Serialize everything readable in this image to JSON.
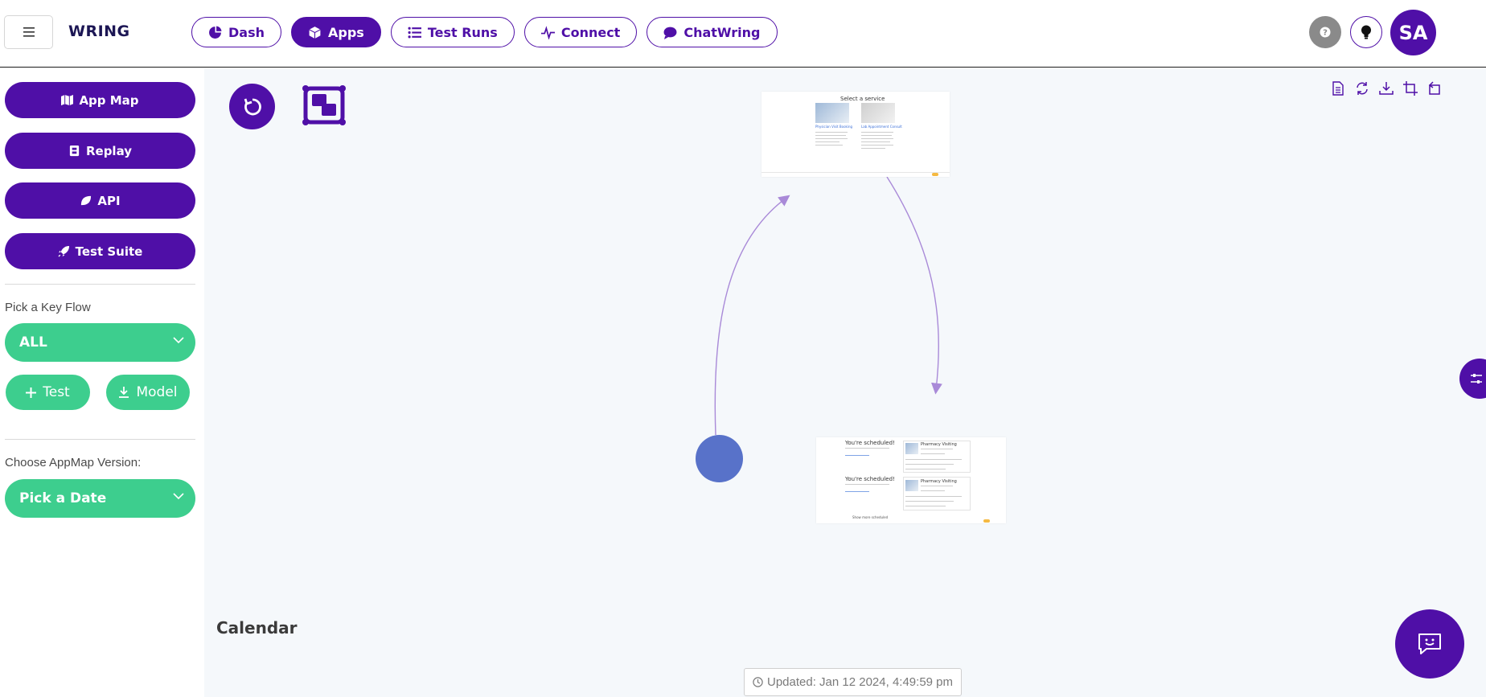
{
  "header": {
    "brand": "WRING",
    "nav": [
      {
        "label": "Dash",
        "icon": "pie-chart-icon",
        "active": false
      },
      {
        "label": "Apps",
        "icon": "cube-icon",
        "active": true
      },
      {
        "label": "Test Runs",
        "icon": "list-icon",
        "active": false
      },
      {
        "label": "Connect",
        "icon": "pulse-icon",
        "active": false
      },
      {
        "label": "ChatWring",
        "icon": "chat-bubble-icon",
        "active": false
      }
    ],
    "avatar_initials": "SA"
  },
  "sidebar": {
    "buttons": [
      {
        "label": "App Map",
        "icon": "map-icon"
      },
      {
        "label": "Replay",
        "icon": "film-icon"
      },
      {
        "label": "API",
        "icon": "leaf-icon"
      },
      {
        "label": "Test Suite",
        "icon": "rocket-icon"
      }
    ],
    "key_flow_label": "Pick a Key Flow",
    "key_flow_value": "ALL",
    "test_button": "Test",
    "model_button": "Model",
    "version_label": "Choose AppMap Version:",
    "version_value": "Pick a Date"
  },
  "canvas": {
    "title": "Calendar",
    "updated": "Updated: Jan 12 2024, 4:49:59 pm",
    "thumb1": {
      "heading": "Select a service",
      "card1_title": "Physician Visit Booking",
      "card2_title": "Lab Appointment Consult"
    },
    "thumb2": {
      "confirm1": "You're scheduled!",
      "confirm2": "You're scheduled!",
      "side1": "Pharmacy Visiting",
      "side2": "Pharmacy Visiting",
      "footer": "Show more scheduled"
    }
  },
  "colors": {
    "primary": "#4f0fa7",
    "green": "#3dce8e",
    "node": "#5872c9",
    "edge": "#a98ad8"
  }
}
